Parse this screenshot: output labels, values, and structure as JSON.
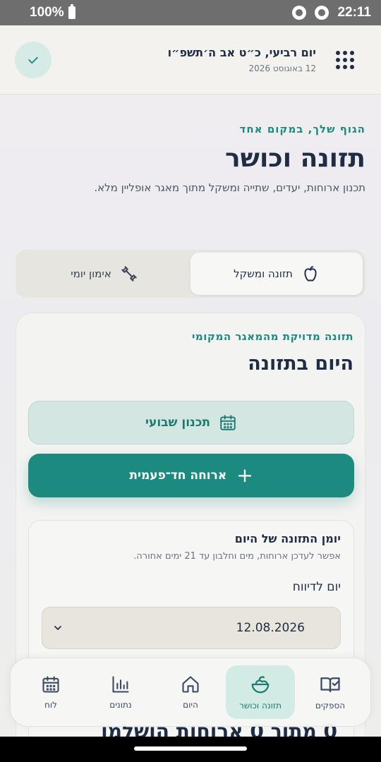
{
  "status_bar": {
    "battery": "100%",
    "time": "22:11"
  },
  "header": {
    "hebrew_date": "יום רביעי, כ״ט אב ה׳תשפ״ו",
    "gregorian_date": "12 באוגוסט 2026"
  },
  "hero": {
    "eyebrow": "הגוף שלך, במקום אחד",
    "title": "תזונה וכושר",
    "subtitle": "תכנון ארוחות, יעדים, שתייה ומשקל מתוך מאגר אופליין מלא."
  },
  "tabs": [
    {
      "label": "תזונה ומשקל",
      "icon": "apple-icon",
      "active": true
    },
    {
      "label": "אימון יומי",
      "icon": "dumbbell-icon",
      "active": false
    }
  ],
  "card": {
    "eyebrow": "תזונה מדויקת מהמאגר המקומי",
    "title": "היום בתזונה",
    "weekly_plan_label": "תכנון שבועי",
    "one_time_meal_label": "ארוחה חד־פעמית",
    "diary": {
      "title": "יומן התזונה של היום",
      "subtitle": "אפשר לעדכן ארוחות, מים וחלבון עד 21 ימים אחורה.",
      "day_label": "יום לדיווח",
      "selected_date": "12.08.2026"
    },
    "behind_text": "0 מתוך 0 ארוחות הושלמו"
  },
  "bottom_nav": [
    {
      "label": "לוח",
      "icon": "calendar-icon"
    },
    {
      "label": "נתונים",
      "icon": "bar-chart-icon"
    },
    {
      "label": "היום",
      "icon": "home-icon"
    },
    {
      "label": "תזונה וכושר",
      "icon": "salad-bowl-icon",
      "active": true
    },
    {
      "label": "הספקים",
      "icon": "book-check-icon"
    }
  ],
  "colors": {
    "accent": "#1d8a7f",
    "accent_light": "#d3e6e2",
    "text_dark": "#1f2d44"
  }
}
